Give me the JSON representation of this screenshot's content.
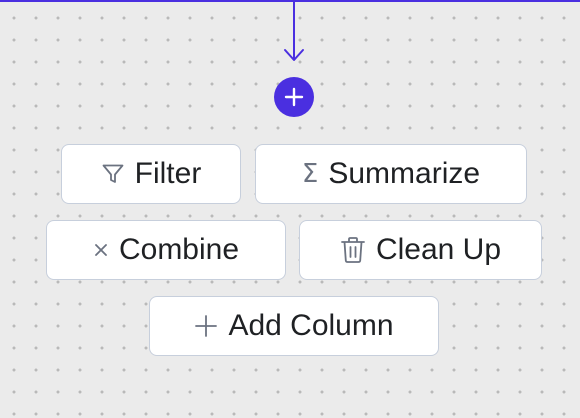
{
  "colors": {
    "accent": "#4a2fe0",
    "button_border": "#c7cfdc",
    "icon_gray": "#6b7280",
    "text": "#1f2124",
    "canvas_bg": "#ebebeb"
  },
  "add_node": {
    "icon": "plus-icon"
  },
  "actions": {
    "filter": {
      "label": "Filter",
      "icon": "filter-funnel-icon"
    },
    "summarize": {
      "label": "Summarize",
      "icon": "sigma-icon",
      "glyph": "Σ"
    },
    "combine": {
      "label": "Combine",
      "icon": "cross-icon"
    },
    "clean_up": {
      "label": "Clean Up",
      "icon": "trash-icon"
    },
    "add_column": {
      "label": "Add Column",
      "icon": "plus-icon"
    }
  }
}
